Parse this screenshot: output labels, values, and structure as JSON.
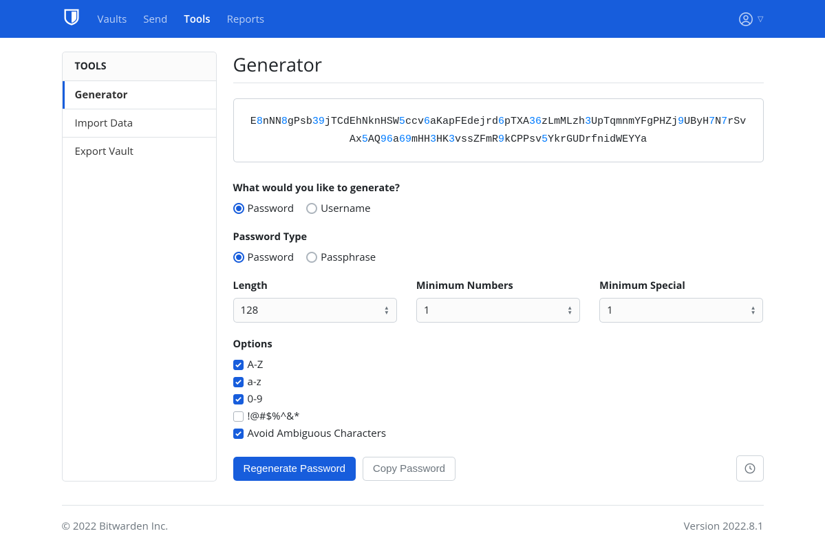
{
  "nav": {
    "links": [
      "Vaults",
      "Send",
      "Tools",
      "Reports"
    ],
    "active": "Tools"
  },
  "sidebar": {
    "header": "TOOLS",
    "items": [
      "Generator",
      "Import Data",
      "Export Vault"
    ],
    "active": "Generator"
  },
  "page": {
    "title": "Generator"
  },
  "generated_password": {
    "segments": [
      {
        "t": "E",
        "c": "l"
      },
      {
        "t": "8",
        "c": "n"
      },
      {
        "t": "nNN",
        "c": "l"
      },
      {
        "t": "8",
        "c": "n"
      },
      {
        "t": "gPsb",
        "c": "l"
      },
      {
        "t": "39",
        "c": "n"
      },
      {
        "t": "jTCdEhNknHSW",
        "c": "l"
      },
      {
        "t": "5",
        "c": "n"
      },
      {
        "t": "ccv",
        "c": "l"
      },
      {
        "t": "6",
        "c": "n"
      },
      {
        "t": "aKapFEdejrd",
        "c": "l"
      },
      {
        "t": "6",
        "c": "n"
      },
      {
        "t": "pTXA",
        "c": "l"
      },
      {
        "t": "36",
        "c": "n"
      },
      {
        "t": "zLmMLzh",
        "c": "l"
      },
      {
        "t": "3",
        "c": "n"
      },
      {
        "t": "UpTqmnmYFgPHZj",
        "c": "l"
      },
      {
        "t": "9",
        "c": "n"
      },
      {
        "t": "UByH",
        "c": "l"
      },
      {
        "t": "7",
        "c": "n"
      },
      {
        "t": "N",
        "c": "l"
      },
      {
        "t": "7",
        "c": "n"
      },
      {
        "t": "rSvAx",
        "c": "l"
      },
      {
        "t": "5",
        "c": "n"
      },
      {
        "t": "AQ",
        "c": "l"
      },
      {
        "t": "96",
        "c": "n"
      },
      {
        "t": "a",
        "c": "l"
      },
      {
        "t": "69",
        "c": "n"
      },
      {
        "t": "mHH",
        "c": "l"
      },
      {
        "t": "3",
        "c": "n"
      },
      {
        "t": "HK",
        "c": "l"
      },
      {
        "t": "3",
        "c": "n"
      },
      {
        "t": "vssZFmR",
        "c": "l"
      },
      {
        "t": "9",
        "c": "n"
      },
      {
        "t": "kCPPsv",
        "c": "l"
      },
      {
        "t": "5",
        "c": "n"
      },
      {
        "t": "YkrGUDrfnidWEYYa",
        "c": "l"
      }
    ]
  },
  "generate_type": {
    "label": "What would you like to generate?",
    "options": [
      "Password",
      "Username"
    ],
    "selected": "Password"
  },
  "password_type": {
    "label": "Password Type",
    "options": [
      "Password",
      "Passphrase"
    ],
    "selected": "Password"
  },
  "inputs": {
    "length": {
      "label": "Length",
      "value": "128"
    },
    "min_numbers": {
      "label": "Minimum Numbers",
      "value": "1"
    },
    "min_special": {
      "label": "Minimum Special",
      "value": "1"
    }
  },
  "options": {
    "label": "Options",
    "items": [
      {
        "label": "A-Z",
        "checked": true
      },
      {
        "label": "a-z",
        "checked": true
      },
      {
        "label": "0-9",
        "checked": true
      },
      {
        "label": "!@#$%^&*",
        "checked": false
      },
      {
        "label": "Avoid Ambiguous Characters",
        "checked": true
      }
    ]
  },
  "buttons": {
    "regenerate": "Regenerate Password",
    "copy": "Copy Password"
  },
  "footer": {
    "copyright": "© 2022 Bitwarden Inc.",
    "version": "Version 2022.8.1"
  }
}
